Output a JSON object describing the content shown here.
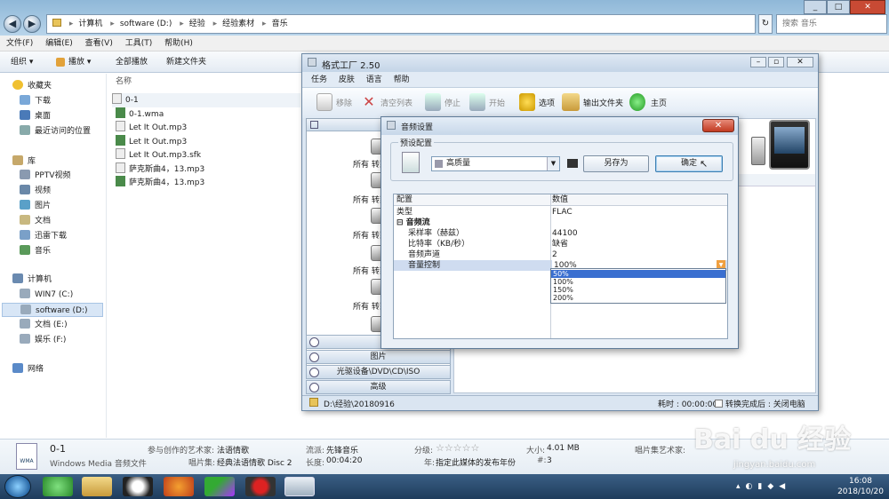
{
  "explorer": {
    "address": {
      "crumbs": [
        "计算机",
        "software (D:)",
        "经验",
        "经验素材",
        "音乐"
      ]
    },
    "search_placeholder": "搜索 音乐",
    "menu": [
      "文件(F)",
      "编辑(E)",
      "查看(V)",
      "工具(T)",
      "帮助(H)"
    ],
    "toolbar": {
      "organize": "组织 ▾",
      "play": "播放 ▾",
      "play_all": "全部播放",
      "new_folder": "新建文件夹"
    },
    "sidebar": {
      "favorites_header": "收藏夹",
      "favorites": [
        "下载",
        "桌面",
        "最近访问的位置"
      ],
      "libraries_header": "库",
      "libraries": [
        "PPTV视频",
        "视频",
        "图片",
        "文档",
        "迅雷下载",
        "音乐"
      ],
      "computer_header": "计算机",
      "drives": [
        "WIN7 (C:)",
        "software (D:)",
        "文档 (E:)",
        "娱乐 (F:)"
      ],
      "network": "网络"
    },
    "list_header": "名称",
    "files": [
      "0-1",
      "0-1.wma",
      "Let It Out.mp3",
      "Let It Out.mp3",
      "Let It Out.mp3.sfk",
      "萨克斯曲4，13.mp3",
      "萨克斯曲4，13.mp3"
    ],
    "details": {
      "name": "0-1",
      "type": "Windows Media 音频文件",
      "artist_label": "参与创作的艺术家:",
      "artist": "法语情歌",
      "album_label": "唱片集:",
      "album": "经典法语情歌 Disc 2",
      "genre_label": "流派:",
      "genre": "先锋音乐",
      "length_label": "长度:",
      "length": "00:04:20",
      "rating_label": "分级:",
      "rating": "☆☆☆☆☆",
      "year_label": "年:",
      "year": "指定此媒体的发布年份",
      "size_label": "大小:",
      "size": "4.01 MB",
      "track_label": "#:",
      "track": "3",
      "album_artist_label": "唱片集艺术家:"
    },
    "wma_label": "WMA"
  },
  "taskbar": {
    "time": "16:08",
    "date": "2018/10/20"
  },
  "format_factory": {
    "title": "格式工厂 2.50",
    "menu": [
      "任务",
      "皮肤",
      "语言",
      "帮助"
    ],
    "toolbar": {
      "remove": "移除",
      "clear": "清空列表",
      "stop": "停止",
      "start": "开始",
      "options": "选项",
      "output_folder": "输出文件夹",
      "home": "主页"
    },
    "convert_label": "所有 转到",
    "sections": {
      "image": "图片",
      "dvd": "光驱设备\\DVD\\CD\\ISO",
      "advanced": "高级"
    },
    "status": {
      "path": "D:\\经验\\20180916",
      "elapsed": "耗时 : 00:00:00",
      "after": "转换完成后 : 关闭电脑"
    }
  },
  "dialog": {
    "title": "音频设置",
    "preset_group": "预设配置",
    "preset_value": "高质量",
    "save_as": "另存为",
    "ok": "确定",
    "grid_headers": [
      "配置",
      "数值"
    ],
    "rows": [
      {
        "k": "类型",
        "v": "FLAC"
      },
      {
        "k": "⊟ 音频流",
        "v": ""
      },
      {
        "k": "采样率（赫兹）",
        "v": "44100"
      },
      {
        "k": "比特率（KB/秒）",
        "v": "缺省"
      },
      {
        "k": "音频声道",
        "v": "2"
      },
      {
        "k": "音量控制",
        "v": "100%"
      }
    ],
    "volume_options": [
      "50%",
      "100%",
      "150%",
      "200%"
    ],
    "volume_selected": "50%"
  },
  "watermark": {
    "main": "Bai du 经验",
    "sub": "jingyan.baidu.com"
  }
}
